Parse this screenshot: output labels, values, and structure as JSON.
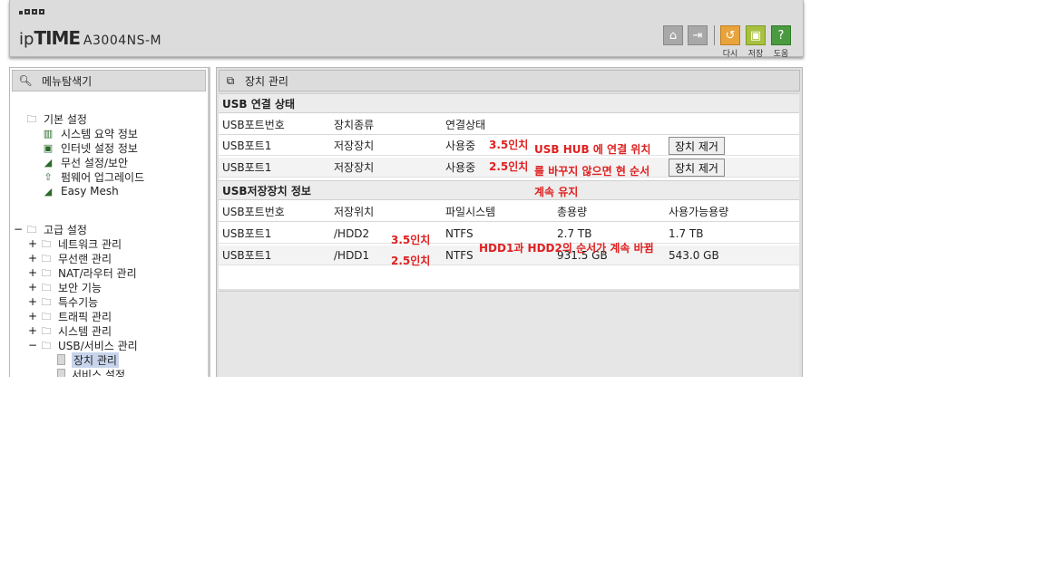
{
  "header": {
    "brand_prefix": "ip",
    "brand_main": "TIME",
    "model": "A3004NS-M",
    "buttons": [
      {
        "name": "home-icon",
        "glyph": "⌂"
      },
      {
        "name": "logout-icon",
        "glyph": "⇥"
      }
    ],
    "actions": [
      {
        "label": "다시",
        "glyph": "↺",
        "color": "#e8a33a"
      },
      {
        "label": "저장",
        "glyph": "▣",
        "color": "#a8c040"
      },
      {
        "label": "도움",
        "glyph": "?",
        "color": "#4a9a40"
      }
    ]
  },
  "sidebar": {
    "title": "메뉴탐색기",
    "basic": {
      "label": "기본 설정",
      "items": [
        "시스템 요약 정보",
        "인터넷 설정 정보",
        "무선 설정/보안",
        "펌웨어 업그레이드",
        "Easy Mesh"
      ]
    },
    "advanced": {
      "toggle": "−",
      "label": "고급 설정",
      "items": [
        {
          "toggle": "+",
          "label": "네트워크 관리"
        },
        {
          "toggle": "+",
          "label": "무선랜 관리"
        },
        {
          "toggle": "+",
          "label": "NAT/라우터 관리"
        },
        {
          "toggle": "+",
          "label": "보안 기능"
        },
        {
          "toggle": "+",
          "label": "특수기능"
        },
        {
          "toggle": "+",
          "label": "트래픽 관리"
        },
        {
          "toggle": "+",
          "label": "시스템 관리"
        },
        {
          "toggle": "−",
          "label": "USB/서비스 관리"
        }
      ],
      "usb_children": [
        "장치 관리",
        "서비스 설정"
      ]
    }
  },
  "main": {
    "title": "장치 관리",
    "usb_status": {
      "title": "USB 연결 상태",
      "columns": [
        "USB포트번호",
        "장치종류",
        "연결상태"
      ],
      "rows": [
        {
          "port": "USB포트1",
          "type": "저장장치",
          "status": "사용중",
          "button": "장치 제거"
        },
        {
          "port": "USB포트1",
          "type": "저장장치",
          "status": "사용중",
          "button": "장치 제거"
        }
      ]
    },
    "storage_info": {
      "title": "USB저장장치 정보",
      "columns": [
        "USB포트번호",
        "저장위치",
        "파일시스템",
        "총용량",
        "사용가능용량"
      ],
      "rows": [
        {
          "port": "USB포트1",
          "location": "/HDD2",
          "fs": "NTFS",
          "total": "2.7 TB",
          "free": "1.7 TB"
        },
        {
          "port": "USB포트1",
          "location": "/HDD1",
          "fs": "NTFS",
          "total": "931.5 GB",
          "free": "543.0 GB"
        }
      ]
    }
  },
  "annotations": {
    "a1": "3.5인치",
    "a2": "2.5인치",
    "note1": "USB HUB 에 연결 위치",
    "note2": "를 바꾸지 않으면 현 순서",
    "note3": "계속 유지",
    "a3": "3.5인치",
    "a4": "2.5인치",
    "note4": "HDD1과 HDD2의 순서가 계속 바뀜"
  }
}
